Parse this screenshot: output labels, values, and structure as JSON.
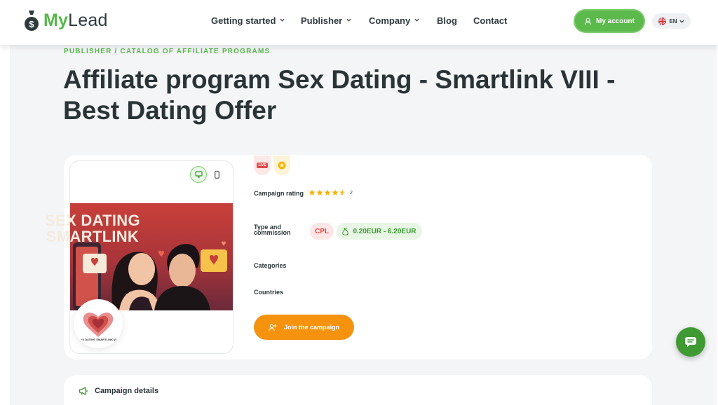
{
  "brand": {
    "my": "My",
    "lead": "Lead",
    "green": "#56b84a"
  },
  "nav": {
    "items": [
      {
        "label": "Getting started",
        "dropdown": true
      },
      {
        "label": "Publisher",
        "dropdown": true
      },
      {
        "label": "Company",
        "dropdown": true
      },
      {
        "label": "Blog",
        "dropdown": false
      },
      {
        "label": "Contact",
        "dropdown": false
      }
    ],
    "account_label": "My account",
    "language": "EN"
  },
  "breadcrumb": "PUBLISHER / CATALOG OF AFFILIATE PROGRAMS",
  "title": "Affiliate program Sex Dating - Smartlink VIII - Best Dating Offer",
  "campaign": {
    "banner_line1": "SEX DATING",
    "banner_line2": "SMARTLINK",
    "logo_caption": "*X DATING SMARTLINK V*",
    "live_tag": "LIVE",
    "rating_label": "Campaign rating",
    "rating_value": 4.5,
    "rating_count": "2",
    "type_label_line1": "Type and",
    "type_label_line2": "commission",
    "type": "CPL",
    "commission": "0.20EUR - 6.20EUR",
    "categories_label": "Categories",
    "countries_label": "Countries",
    "join_label": "Join the campaign"
  },
  "details": {
    "title": "Campaign details"
  },
  "colors": {
    "accent_green": "#56b84a",
    "orange": "#f5920e",
    "cpl_red": "#e34a4a",
    "star": "#f5b50e"
  }
}
